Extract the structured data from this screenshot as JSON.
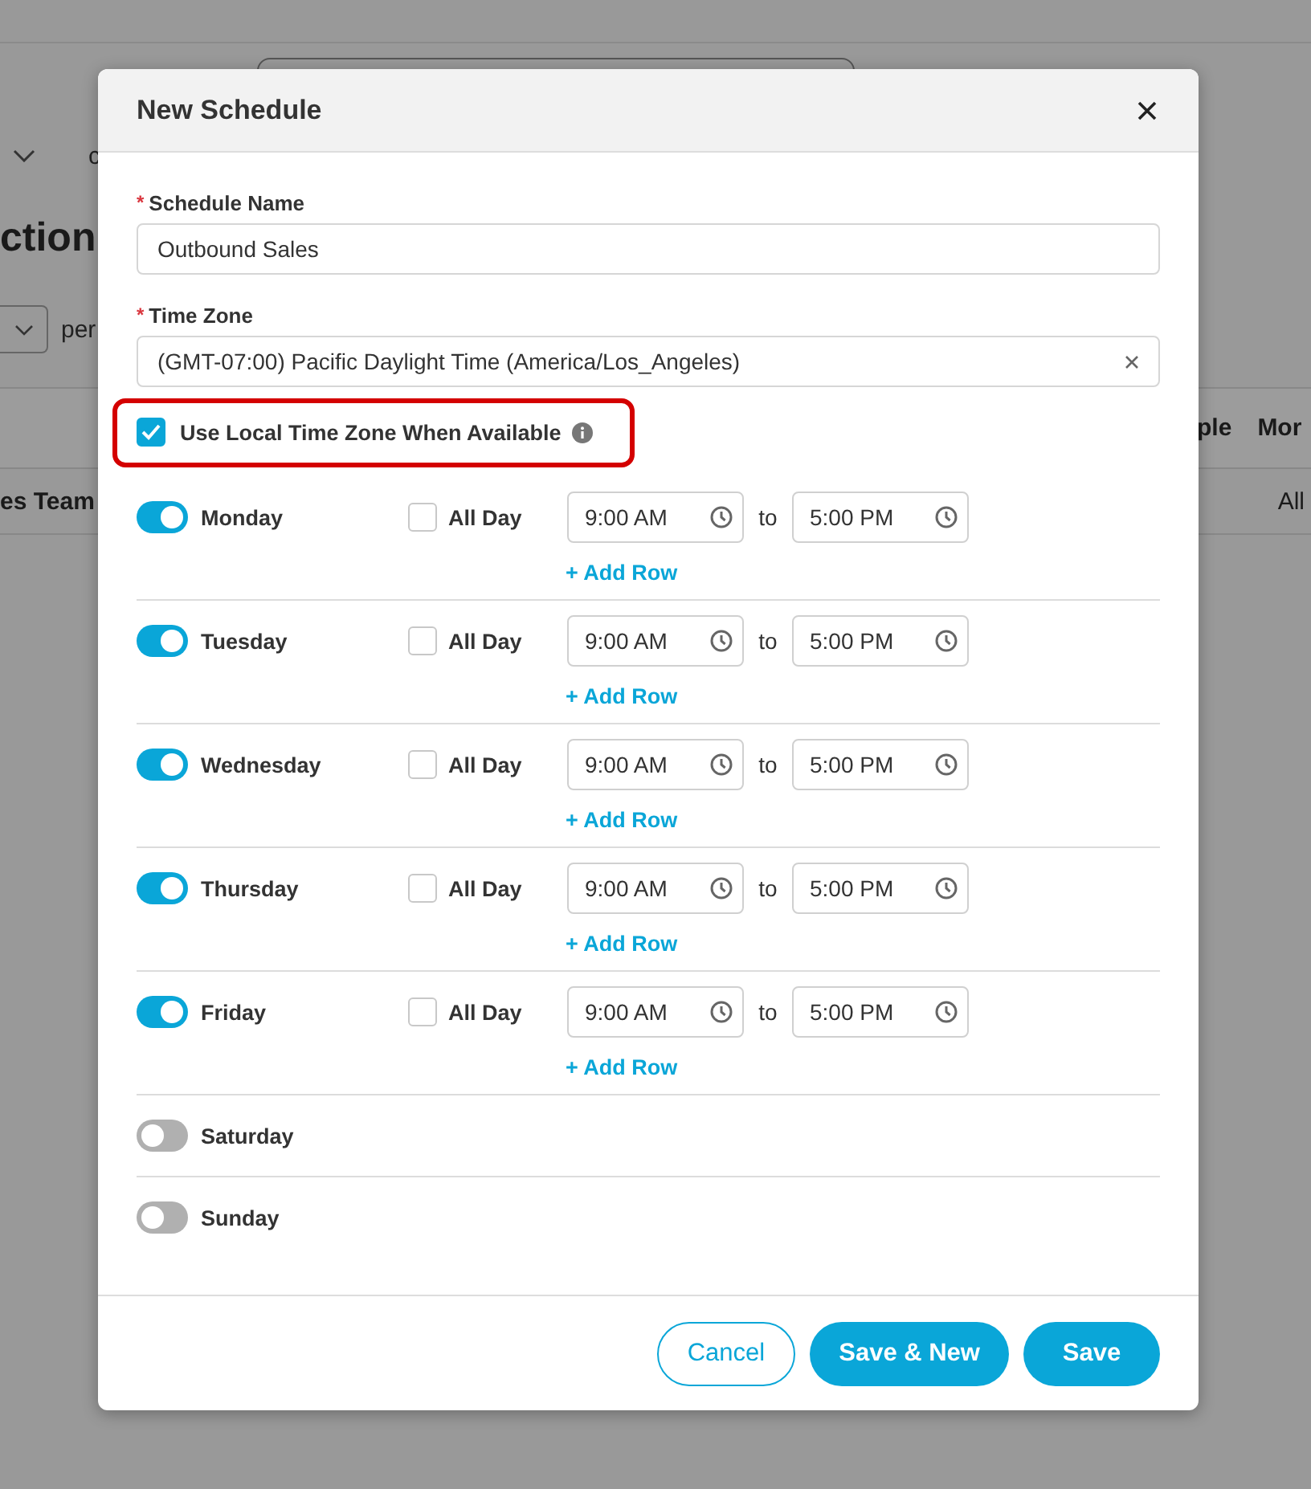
{
  "background_page": {
    "toolbar_text": "c",
    "heading": "ction",
    "filter_text": "per",
    "table": {
      "columns": [
        "ple",
        "Mor"
      ],
      "rows": [
        {
          "name": "es Team",
          "column_2": "All"
        }
      ]
    }
  },
  "dialog": {
    "title": "New Schedule",
    "fields": [
      {
        "label": "Schedule Name",
        "required_mark": "*",
        "value": "Outbound Sales",
        "kind": "text"
      },
      {
        "label": "Time Zone",
        "required_mark": "*",
        "value": "(GMT-07:00) Pacific Daylight Time (America/Los_Angeles)",
        "kind": "select"
      }
    ],
    "local_time_zone": {
      "label": "Use Local Time Zone When Available",
      "checked": true,
      "highlighted": true
    },
    "days": [
      {
        "name": "Monday",
        "on": true,
        "all_day_label": "All Day",
        "all_day": false,
        "ranges": [
          {
            "start": "9:00 AM",
            "separator": "to",
            "end": "5:00 PM"
          }
        ],
        "add_row": "+ Add Row"
      },
      {
        "name": "Tuesday",
        "on": true,
        "all_day_label": "All Day",
        "all_day": false,
        "ranges": [
          {
            "start": "9:00 AM",
            "separator": "to",
            "end": "5:00 PM"
          }
        ],
        "add_row": "+ Add Row"
      },
      {
        "name": "Wednesday",
        "on": true,
        "all_day_label": "All Day",
        "all_day": false,
        "ranges": [
          {
            "start": "9:00 AM",
            "separator": "to",
            "end": "5:00 PM"
          }
        ],
        "add_row": "+ Add Row"
      },
      {
        "name": "Thursday",
        "on": true,
        "all_day_label": "All Day",
        "all_day": false,
        "ranges": [
          {
            "start": "9:00 AM",
            "separator": "to",
            "end": "5:00 PM"
          }
        ],
        "add_row": "+ Add Row"
      },
      {
        "name": "Friday",
        "on": true,
        "all_day_label": "All Day",
        "all_day": false,
        "ranges": [
          {
            "start": "9:00 AM",
            "separator": "to",
            "end": "5:00 PM"
          }
        ],
        "add_row": "+ Add Row"
      },
      {
        "name": "Saturday",
        "on": false
      },
      {
        "name": "Sunday",
        "on": false
      }
    ],
    "buttons": [
      {
        "label": "Cancel",
        "kind": "secondary"
      },
      {
        "label": "Save & New",
        "kind": "primary"
      },
      {
        "label": "Save",
        "kind": "primary"
      }
    ]
  }
}
